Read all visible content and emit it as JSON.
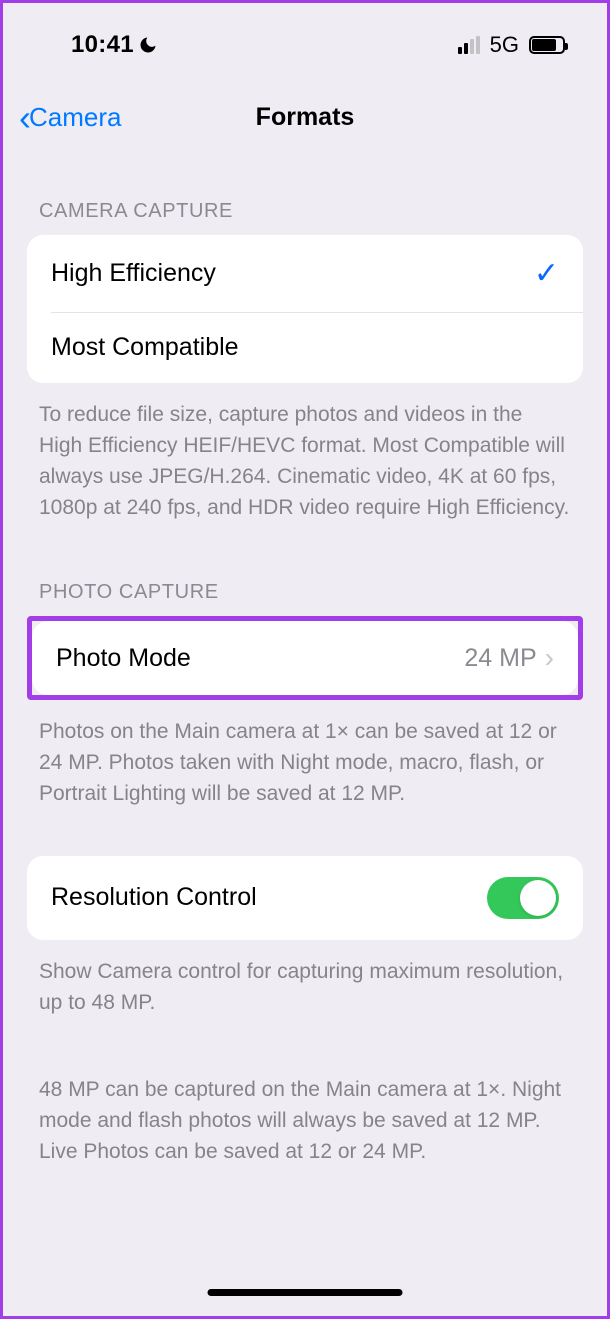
{
  "status": {
    "time": "10:41",
    "network": "5G"
  },
  "nav": {
    "back": "Camera",
    "title": "Formats"
  },
  "sections": {
    "camera_capture": {
      "header": "CAMERA CAPTURE",
      "options": {
        "high_efficiency": "High Efficiency",
        "most_compatible": "Most Compatible"
      },
      "selected": "high_efficiency",
      "footer": "To reduce file size, capture photos and videos in the High Efficiency HEIF/HEVC format. Most Compatible will always use JPEG/H.264. Cinematic video, 4K at 60 fps, 1080p at 240 fps, and HDR video require High Efficiency."
    },
    "photo_capture": {
      "header": "PHOTO CAPTURE",
      "photo_mode": {
        "label": "Photo Mode",
        "value": "24 MP"
      },
      "footer": "Photos on the Main camera at 1× can be saved at 12 or 24 MP. Photos taken with Night mode, macro, flash, or Portrait Lighting will be saved at 12 MP."
    },
    "resolution_control": {
      "label": "Resolution Control",
      "enabled": true,
      "footer1": "Show Camera control for capturing maximum resolution, up to 48 MP.",
      "footer2": "48 MP can be captured on the Main camera at 1×. Night mode and flash photos will always be saved at 12 MP. Live Photos can be saved at 12 or 24 MP."
    }
  }
}
